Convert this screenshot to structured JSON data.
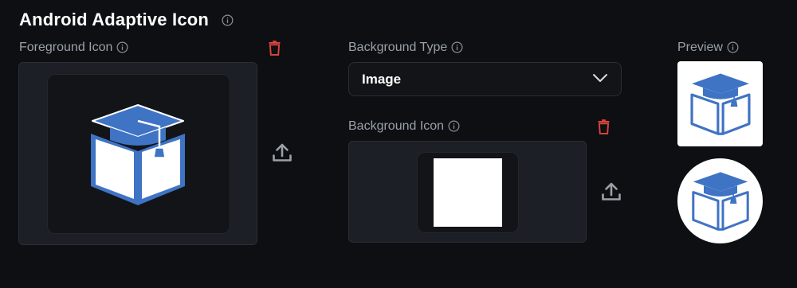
{
  "header": {
    "title": "Android Adaptive Icon"
  },
  "foreground": {
    "label": "Foreground Icon",
    "icon": "graduation-cap-book-icon"
  },
  "background_type": {
    "label": "Background Type",
    "selected": "Image"
  },
  "background_icon": {
    "label": "Background Icon",
    "fill": "#ffffff"
  },
  "preview": {
    "label": "Preview"
  },
  "colors": {
    "accent_blue": "#3f73c4",
    "delete_red": "#e0443b",
    "page_bg": "#0d0f12",
    "panel_bg": "#1c1f25"
  }
}
